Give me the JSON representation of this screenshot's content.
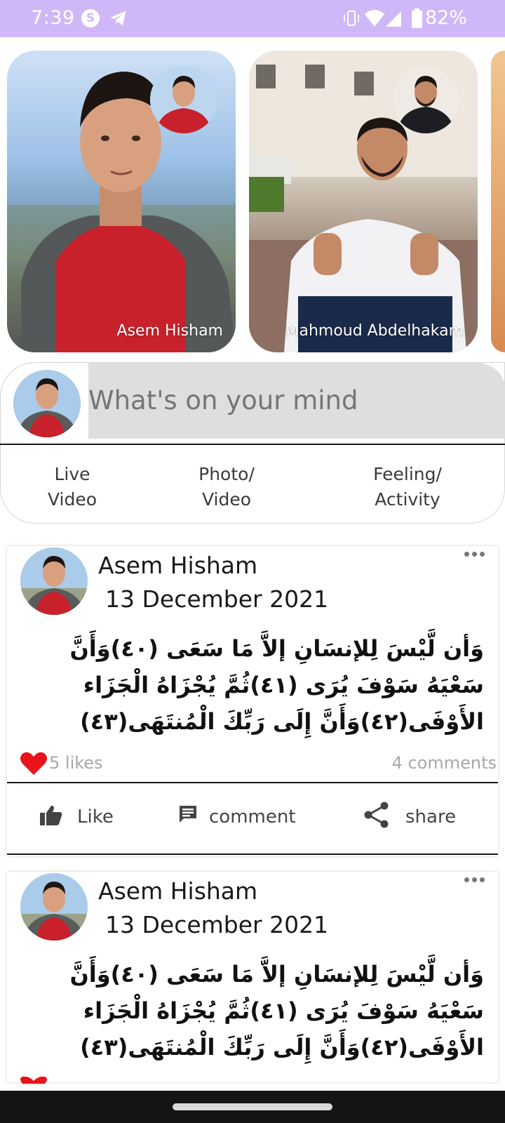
{
  "status_bar": {
    "time": "7:39",
    "app_icon_1": "S",
    "battery": "82%",
    "icons": [
      "skype-icon",
      "telegram-icon",
      "vibrate-icon",
      "wifi-icon",
      "cell-signal-icon",
      "battery-icon"
    ]
  },
  "stories": [
    {
      "name": "Asem Hisham"
    },
    {
      "name": "Mahmoud Abdelhakam"
    }
  ],
  "composer": {
    "placeholder": "What's on your mind"
  },
  "actions": {
    "live_line1": "Live",
    "live_line2": "Video",
    "photo_line1": "Photo/",
    "photo_line2": "Video",
    "feeling_line1": "Feeling/",
    "feeling_line2": "Activity"
  },
  "posts": [
    {
      "author": "Asem Hisham",
      "date": "13 December 2021",
      "text": "وَأن لَّيْسَ لِلإنسَانِ إلاَّ مَا سَعَى (٤٠)وَأَنَّ سَعْيَهُ سَوْفَ يُرَى  (٤١)ثُمَّ يُجْزَاهُ الْجَزَاء الأَوْفَى(٤٢)وَأَنَّ إِلَى رَبِّكَ الْمُنتَهَى(٤٣)",
      "likes": "5 likes",
      "comments": "4 comments",
      "like_label": "Like",
      "comment_label": "comment",
      "share_label": "share"
    },
    {
      "author": "Asem Hisham",
      "date": "13 December 2021",
      "text": "وَأن لَّيْسَ لِلإنسَانِ إلاَّ مَا سَعَى (٤٠)وَأَنَّ سَعْيَهُ سَوْفَ يُرَى  (٤١)ثُمَّ يُجْزَاهُ الْجَزَاء الأَوْفَى(٤٢)وَأَنَّ إِلَى رَبِّكَ الْمُنتَهَى(٤٣)"
    }
  ],
  "colors": {
    "status_bar": "#d0b8f8",
    "heart": "#e8141a",
    "composer_input_bg": "#dedede",
    "nav_bar": "#141414"
  }
}
